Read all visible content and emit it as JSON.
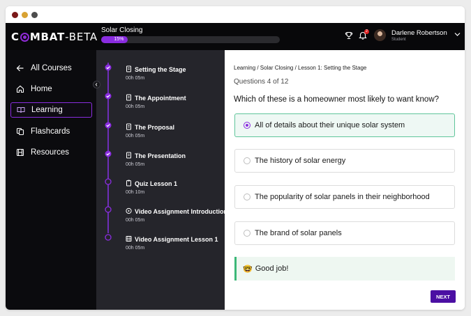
{
  "brand": {
    "logo_c": "C",
    "logo_rest": "MBAT",
    "logo_suffix": "-BETA"
  },
  "header": {
    "course_title": "Solar Closing",
    "progress": {
      "percent": 15,
      "label": "15%"
    },
    "notifications": {
      "count": "2"
    },
    "user": {
      "name": "Darlene Robertson",
      "role": "Student"
    }
  },
  "sidebar": {
    "items": [
      {
        "label": "All Courses",
        "icon": "arrow-left-icon"
      },
      {
        "label": "Home",
        "icon": "home-icon"
      },
      {
        "label": "Learning",
        "icon": "book-icon",
        "active": true
      },
      {
        "label": "Flashcards",
        "icon": "flashcards-icon"
      },
      {
        "label": "Resources",
        "icon": "resources-icon"
      }
    ]
  },
  "lessons": [
    {
      "title": "Setting the Stage",
      "duration": "00h 05m",
      "status": "completed",
      "icon": "page-icon"
    },
    {
      "title": "The Appointment",
      "duration": "00h 05m",
      "status": "completed",
      "icon": "page-icon"
    },
    {
      "title": "The Proposal",
      "duration": "00h 05m",
      "status": "completed",
      "icon": "page-icon"
    },
    {
      "title": "The Presentation",
      "duration": "00h 05m",
      "status": "completed",
      "icon": "page-icon"
    },
    {
      "title": "Quiz Lesson 1",
      "duration": "00h 10m",
      "status": "current",
      "icon": "clipboard-icon"
    },
    {
      "title": "Video Assignment Introduction",
      "duration": "00h 05m",
      "status": "pending",
      "icon": "video-icon"
    },
    {
      "title": "Video Assignment Lesson 1",
      "duration": "00h 05m",
      "status": "pending",
      "icon": "film-icon"
    }
  ],
  "main": {
    "breadcrumb": "Learning / Solar Closing / Lesson 1: Setting the Stage",
    "question_count": "Questions 4 of 12",
    "question": "Which of these is a homeowner most likely to want know?",
    "options": [
      {
        "label": "All of details about their unique solar system",
        "selected": true
      },
      {
        "label": "The history of solar energy",
        "selected": false
      },
      {
        "label": "The popularity of solar panels in their neighborhood",
        "selected": false
      },
      {
        "label": "The brand of solar panels",
        "selected": false
      }
    ],
    "feedback": {
      "emoji": "🤓",
      "text": "Good job!"
    },
    "next_label": "NEXT"
  },
  "colors": {
    "accent": "#8a2ce0",
    "success": "#3cb878",
    "button": "#4b0fa3"
  }
}
